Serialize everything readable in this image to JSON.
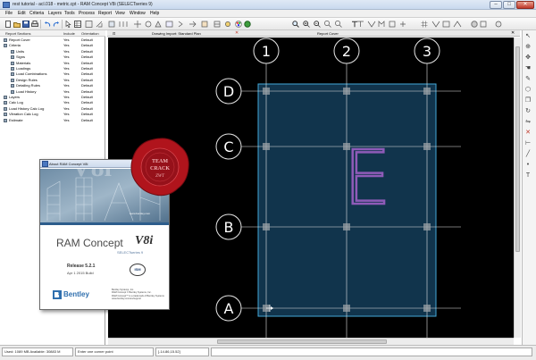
{
  "window": {
    "title": "rest tutorial - acl.018 - metric.cpt - RAM Concept V8i (SELECTseries 9)",
    "controls": [
      "–",
      "□",
      "✕"
    ]
  },
  "menu": [
    "File",
    "Edit",
    "Criteria",
    "Layers",
    "Tools",
    "Process",
    "Report",
    "View",
    "Window",
    "Help"
  ],
  "toolbar": {
    "icons": [
      "new-icon",
      "open-icon",
      "save-icon",
      "print-icon",
      "undo-icon",
      "redo-icon",
      "select-icon",
      "table-icon",
      "color-icon",
      "fill-icon",
      "zoom-icon",
      "zoom-in-icon",
      "zoom-out-icon",
      "text-icon",
      "grid-icon",
      "pan-icon"
    ]
  },
  "report_tree": {
    "headers": [
      "Report Sections",
      "Include",
      "Orientation"
    ],
    "rows": [
      {
        "label": "Report Cover",
        "include": "Yes",
        "orientation": "Default",
        "indent": 1
      },
      {
        "label": "Criteria",
        "include": "Yes",
        "orientation": "Default",
        "indent": 1
      },
      {
        "label": "Units",
        "include": "Yes",
        "orientation": "Default",
        "indent": 2
      },
      {
        "label": "Signs",
        "include": "Yes",
        "orientation": "Default",
        "indent": 2
      },
      {
        "label": "Materials",
        "include": "Yes",
        "orientation": "Default",
        "indent": 2
      },
      {
        "label": "Loadings",
        "include": "Yes",
        "orientation": "Default",
        "indent": 2
      },
      {
        "label": "Load Combinations",
        "include": "Yes",
        "orientation": "Default",
        "indent": 2
      },
      {
        "label": "Design Rules",
        "include": "Yes",
        "orientation": "Default",
        "indent": 2
      },
      {
        "label": "Detailing Rules",
        "include": "Yes",
        "orientation": "Default",
        "indent": 2
      },
      {
        "label": "Load History",
        "include": "Yes",
        "orientation": "Default",
        "indent": 2
      },
      {
        "label": "Layers",
        "include": "Yes",
        "orientation": "Default",
        "indent": 1
      },
      {
        "label": "Calc Log",
        "include": "Yes",
        "orientation": "Default",
        "indent": 1
      },
      {
        "label": "Load History Calc Log",
        "include": "Yes",
        "orientation": "Default",
        "indent": 1
      },
      {
        "label": "Vibration Calc Log",
        "include": "Yes",
        "orientation": "Default",
        "indent": 1
      },
      {
        "label": "Estimate",
        "include": "Yes",
        "orientation": "Default",
        "indent": 1
      }
    ]
  },
  "canvas_tabs": {
    "left": "Drawing Import: Standard Plan",
    "right": "Report Cover"
  },
  "grid": {
    "columns": [
      "1",
      "2",
      "3"
    ],
    "rows": [
      "D",
      "C",
      "B",
      "A"
    ],
    "letter": "E",
    "colors": {
      "line": "#e6e6e6",
      "slab_fill": "#1f5f8a",
      "slab_stroke": "#43a8d8",
      "letter": "#8e5bb8",
      "column": "#9aa0a6"
    }
  },
  "about": {
    "title": "About RAM Concept V8i",
    "url": "www.bentley.com",
    "product": "RAM Concept",
    "brand": "V8i",
    "series": "SELECTseries 9",
    "release": "Release 5.2.1",
    "build": "Apr 1 2015 Build",
    "company": "Bentley",
    "isp_badge": "ISM",
    "legal_lines": [
      "Bentley Systems, Inc.",
      "RAM Concept © Bentley Systems, Inc.",
      "RAM Concept™ is a trademark of Bentley Systems",
      "www.bentley.com/en/support"
    ]
  },
  "seal": {
    "line1": "TEAM",
    "line2": "CRACK",
    "line3": "ZWT"
  },
  "status": {
    "memory": "Used: 1089 MB  Available: 30883 M",
    "prompt": "Enter one corner point",
    "coords": "[-14.86,15.52]"
  }
}
